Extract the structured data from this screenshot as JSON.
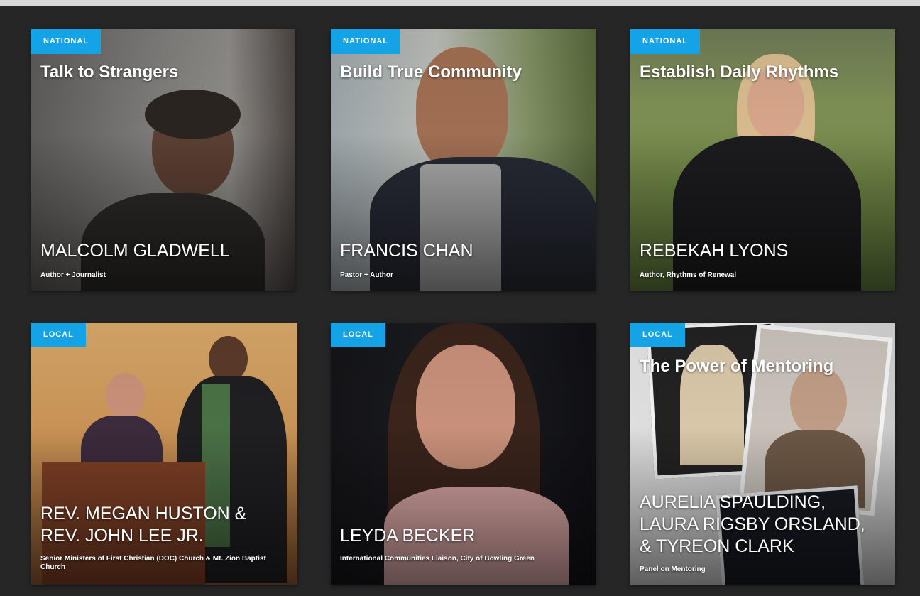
{
  "colors": {
    "background": "#262626",
    "badge": "#14a3e6",
    "text": "#ffffff"
  },
  "cards": [
    {
      "badge": "NATIONAL",
      "title": "Talk to Strangers",
      "name": "MALCOLM GLADWELL",
      "role": "Author + Journalist"
    },
    {
      "badge": "NATIONAL",
      "title": "Build True Community",
      "name": "FRANCIS CHAN",
      "role": "Pastor + Author"
    },
    {
      "badge": "NATIONAL",
      "title": "Establish Daily Rhythms",
      "name": "REBEKAH LYONS",
      "role": "Author, Rhythms of Renewal"
    },
    {
      "badge": "LOCAL",
      "title": "",
      "name": "REV. MEGAN HUSTON & REV. JOHN LEE JR.",
      "role": "Senior Ministers of First Christian (DOC) Church & Mt. Zion Baptist Church"
    },
    {
      "badge": "LOCAL",
      "title": "",
      "name": "LEYDA BECKER",
      "role": "International Communities Liaison, City of Bowling Green"
    },
    {
      "badge": "LOCAL",
      "title": "The Power of Mentoring",
      "name": "AURELIA SPAULDING, LAURA RIGSBY ORSLAND, & TYREON CLARK",
      "role": "Panel on Mentoring"
    }
  ]
}
